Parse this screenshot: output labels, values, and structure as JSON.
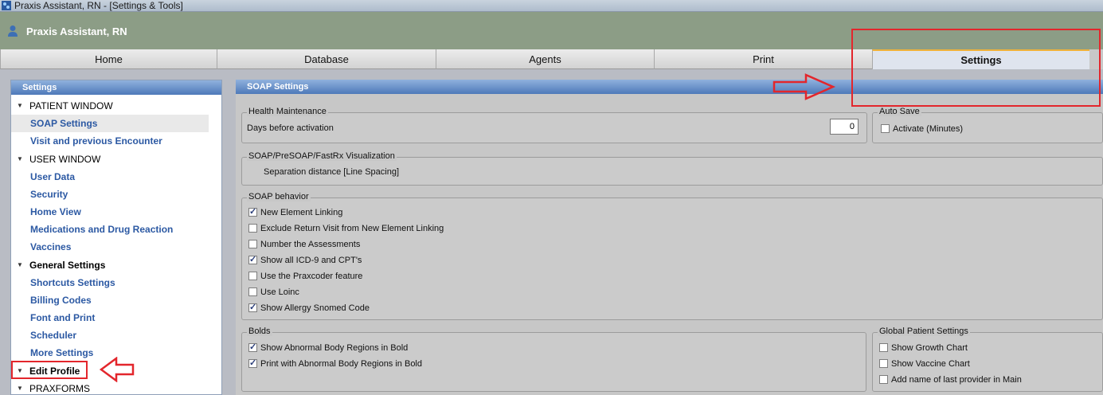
{
  "window": {
    "title": "Praxis Assistant, RN - [Settings & Tools]"
  },
  "header": {
    "user_name": "Praxis Assistant, RN",
    "user_icon": "person-icon"
  },
  "tabs": [
    {
      "label": "Home"
    },
    {
      "label": "Database"
    },
    {
      "label": "Agents"
    },
    {
      "label": "Print"
    },
    {
      "label": "Settings",
      "active": true
    }
  ],
  "sidebar": {
    "title": "Settings",
    "items": [
      {
        "label": "PATIENT WINDOW",
        "type": "group"
      },
      {
        "label": "SOAP Settings",
        "type": "link",
        "selected": true
      },
      {
        "label": "Visit and previous Encounter",
        "type": "link"
      },
      {
        "label": "USER WINDOW",
        "type": "group"
      },
      {
        "label": "User Data",
        "type": "link"
      },
      {
        "label": "Security",
        "type": "link"
      },
      {
        "label": "Home View",
        "type": "link"
      },
      {
        "label": "Medications and Drug Reaction",
        "type": "link"
      },
      {
        "label": "Vaccines",
        "type": "link"
      },
      {
        "label": "General Settings",
        "type": "group"
      },
      {
        "label": "Shortcuts Settings",
        "type": "link"
      },
      {
        "label": "Billing Codes",
        "type": "link"
      },
      {
        "label": "Font and Print",
        "type": "link"
      },
      {
        "label": "Scheduler",
        "type": "link"
      },
      {
        "label": "More Settings",
        "type": "link"
      },
      {
        "label": "Edit Profile",
        "type": "group"
      },
      {
        "label": "PRAXFORMS",
        "type": "group"
      }
    ]
  },
  "main": {
    "title": "SOAP Settings",
    "health_maintenance": {
      "legend": "Health Maintenance",
      "label": "Days before activation",
      "value": "0"
    },
    "auto_save": {
      "legend": "Auto Save",
      "label": "Activate (Minutes)",
      "checked": false
    },
    "visualization": {
      "legend": "SOAP/PreSOAP/FastRx Visualization",
      "label": "Separation distance [Line Spacing]"
    },
    "soap_behavior": {
      "legend": "SOAP behavior",
      "options": [
        {
          "label": "New Element Linking",
          "checked": true
        },
        {
          "label": "Exclude Return Visit from New Element Linking",
          "checked": false
        },
        {
          "label": "Number the Assessments",
          "checked": false
        },
        {
          "label": "Show all ICD-9 and CPT's",
          "checked": true
        },
        {
          "label": "Use the Praxcoder feature",
          "checked": false
        },
        {
          "label": "Use Loinc",
          "checked": false
        },
        {
          "label": "Show Allergy Snomed Code",
          "checked": true
        }
      ]
    },
    "bolds": {
      "legend": "Bolds",
      "options": [
        {
          "label": "Show Abnormal Body Regions in Bold",
          "checked": true
        },
        {
          "label": "Print with Abnormal Body Regions in Bold",
          "checked": true
        }
      ]
    },
    "global_patient": {
      "legend": "Global Patient Settings",
      "options": [
        {
          "label": "Show Growth Chart",
          "checked": false
        },
        {
          "label": "Show Vaccine Chart",
          "checked": false
        },
        {
          "label": "Add name of last provider in Main",
          "checked": false
        }
      ]
    }
  },
  "colors": {
    "annotation": "#e3262c",
    "link": "#2c59a3",
    "header_bg": "#8c9d86",
    "panel_header": "#4e79b9"
  }
}
